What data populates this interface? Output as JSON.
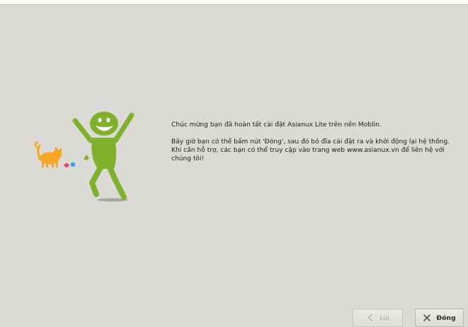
{
  "message": {
    "line1": "Chúc mừng bạn đã hoàn tất cài đặt Asianux Lite trên nền Moblin.",
    "line2": "Bây giờ bạn có thể bấm nút 'Đóng', sau đó bỏ đĩa cài đặt ra và khởi động lại hệ thống.",
    "line3": "Khi cần hỗ trợ, các bạn có thể truy cập vào trang web www.asianux.vn để liên hệ với chúng tôi!"
  },
  "buttons": {
    "back_label": "Lùi",
    "close_label": "Đóng"
  },
  "colors": {
    "background": "#dcdad5",
    "figure_green": "#7fb12b",
    "cat_orange": "#f6a623"
  },
  "icons": {
    "back": "chevron-left-icon",
    "close": "close-icon"
  }
}
